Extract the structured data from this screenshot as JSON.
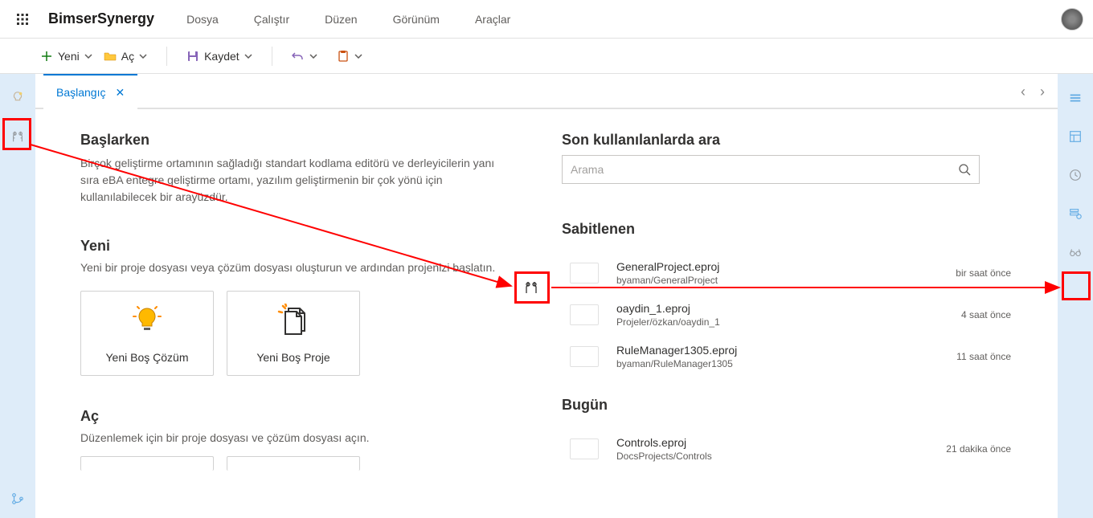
{
  "header": {
    "app_title": "BimserSynergy",
    "menu": [
      "Dosya",
      "Çalıştır",
      "Düzen",
      "Görünüm",
      "Araçlar"
    ]
  },
  "toolbar": {
    "new_label": "Yeni",
    "open_label": "Aç",
    "save_label": "Kaydet"
  },
  "tabs": {
    "active": "Başlangıç"
  },
  "start": {
    "getting_started_title": "Başlarken",
    "getting_started_desc": "Birçok geliştirme ortamının sağladığı standart kodlama editörü ve derleyicilerin yanı sıra eBA entegre geliştirme ortamı, yazılım geliştirmenin bir çok yönü için kullanılabilecek bir arayüzdür.",
    "new_title": "Yeni",
    "new_desc": "Yeni bir proje dosyası veya çözüm dosyası oluşturun ve ardından projenizi başlatın.",
    "tile_solution": "Yeni Boş Çözüm",
    "tile_project": "Yeni Boş Proje",
    "open_title": "Aç",
    "open_desc": "Düzenlemek için bir proje dosyası ve çözüm dosyası açın."
  },
  "right": {
    "search_title": "Son kullanılanlarda ara",
    "search_placeholder": "Arama",
    "pinned_title": "Sabitlenen",
    "today_title": "Bugün",
    "pinned": [
      {
        "name": "GeneralProject.eproj",
        "path": "byaman/GeneralProject",
        "time": "bir saat önce"
      },
      {
        "name": "oaydin_1.eproj",
        "path": "Projeler/özkan/oaydin_1",
        "time": "4 saat önce"
      },
      {
        "name": "RuleManager1305.eproj",
        "path": "byaman/RuleManager1305",
        "time": "11 saat önce"
      }
    ],
    "today": [
      {
        "name": "Controls.eproj",
        "path": "DocsProjects/Controls",
        "time": "21 dakika önce"
      }
    ]
  }
}
